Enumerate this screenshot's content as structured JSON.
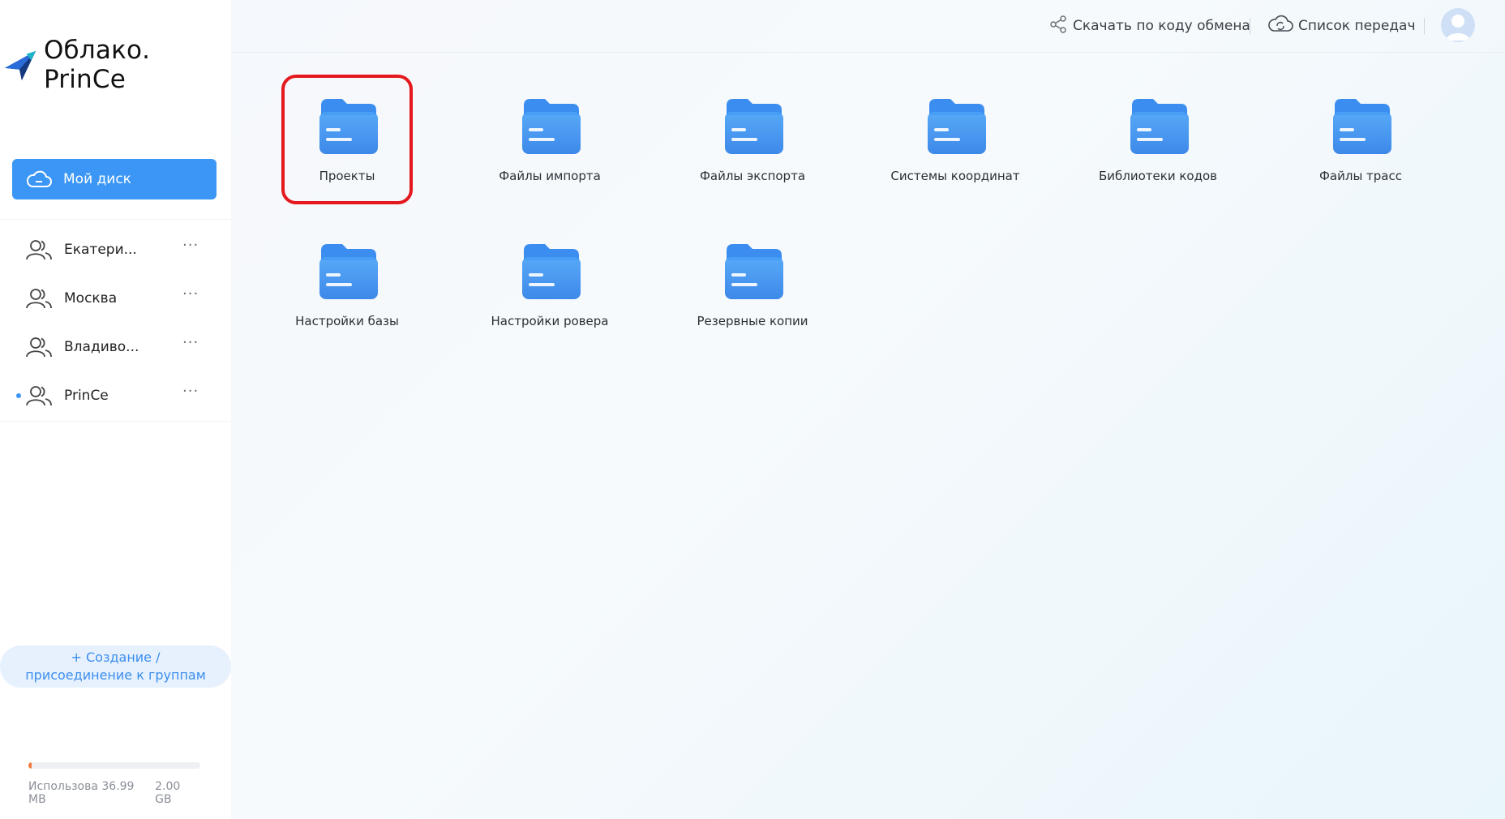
{
  "app": {
    "logo_text": "Облако. PrinCe"
  },
  "sidebar": {
    "my_disk_label": "Мой диск",
    "groups": [
      {
        "label": "Екатери...",
        "more": "···",
        "active": false
      },
      {
        "label": "Москва",
        "more": "···",
        "active": false
      },
      {
        "label": "Владиво...",
        "more": "···",
        "active": false
      },
      {
        "label": "PrinCe",
        "more": "···",
        "active": true
      }
    ],
    "create_join_label": "+ Создание /\nприсоединение к группам",
    "storage": {
      "used_label": "Использова 36.99 MB",
      "total_label": "2.00 GB",
      "used_fraction": 0.018
    }
  },
  "topbar": {
    "download_by_code_label": "Скачать по коду обмена",
    "transfer_list_label": "Список передач"
  },
  "folders": [
    {
      "name": "Проекты",
      "highlighted": true
    },
    {
      "name": "Файлы импорта"
    },
    {
      "name": "Файлы экспорта"
    },
    {
      "name": "Системы координат"
    },
    {
      "name": "Библиотеки кодов"
    },
    {
      "name": "Файлы трасс"
    },
    {
      "name": "Настройки базы"
    },
    {
      "name": "Настройки ровера"
    },
    {
      "name": "Резервные копии"
    }
  ],
  "colors": {
    "accent": "#3b96f6",
    "highlight_border": "#e5181e",
    "storage_fill": "#f17b3d"
  }
}
